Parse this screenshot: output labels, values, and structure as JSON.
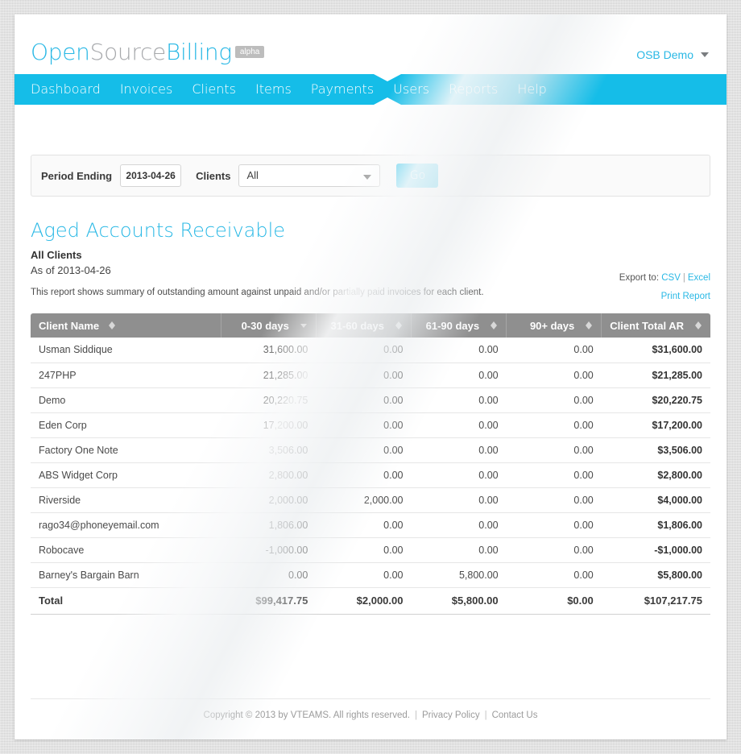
{
  "header": {
    "logo": {
      "part1": "Open",
      "part2": "Source",
      "part3": "Billing",
      "badge": "alpha"
    },
    "user_menu": "OSB Demo"
  },
  "nav": {
    "items": [
      {
        "label": "Dashboard",
        "active": false
      },
      {
        "label": "Invoices",
        "active": false
      },
      {
        "label": "Clients",
        "active": false
      },
      {
        "label": "Items",
        "active": false
      },
      {
        "label": "Payments",
        "active": false
      },
      {
        "label": "Users",
        "active": false
      },
      {
        "label": "Reports",
        "active": true
      },
      {
        "label": "Help",
        "active": false
      }
    ]
  },
  "filter": {
    "period_label": "Period Ending",
    "period_value": "2013-04-26",
    "clients_label": "Clients",
    "clients_value": "All",
    "go_label": "Go"
  },
  "report": {
    "title": "Aged Accounts Receivable",
    "subtitle": "All Clients",
    "as_of": "As of 2013-04-26",
    "description": "This report shows summary of outstanding amount against unpaid and/or partially paid invoices for each client.",
    "export_label": "Export to:",
    "export_csv": "CSV",
    "export_excel": "Excel",
    "print_report": "Print Report"
  },
  "table": {
    "columns": [
      {
        "label": "Client Name",
        "align": "left",
        "sort": "both"
      },
      {
        "label": "0-30 days",
        "align": "right",
        "sort": "desc"
      },
      {
        "label": "31-60 days",
        "align": "right",
        "sort": "both"
      },
      {
        "label": "61-90 days",
        "align": "right",
        "sort": "both"
      },
      {
        "label": "90+ days",
        "align": "right",
        "sort": "both"
      },
      {
        "label": "Client Total AR",
        "align": "right",
        "sort": "both"
      }
    ],
    "rows": [
      {
        "name": "Usman Siddique",
        "d030": "31,600.00",
        "d3160": "0.00",
        "d6190": "0.00",
        "d90": "0.00",
        "total": "$31,600.00"
      },
      {
        "name": "247PHP",
        "d030": "21,285.00",
        "d3160": "0.00",
        "d6190": "0.00",
        "d90": "0.00",
        "total": "$21,285.00"
      },
      {
        "name": "Demo",
        "d030": "20,220.75",
        "d3160": "0.00",
        "d6190": "0.00",
        "d90": "0.00",
        "total": "$20,220.75"
      },
      {
        "name": "Eden Corp",
        "d030": "17,200.00",
        "d3160": "0.00",
        "d6190": "0.00",
        "d90": "0.00",
        "total": "$17,200.00"
      },
      {
        "name": "Factory One Note",
        "d030": "3,506.00",
        "d3160": "0.00",
        "d6190": "0.00",
        "d90": "0.00",
        "total": "$3,506.00"
      },
      {
        "name": "ABS Widget Corp",
        "d030": "2,800.00",
        "d3160": "0.00",
        "d6190": "0.00",
        "d90": "0.00",
        "total": "$2,800.00"
      },
      {
        "name": "Riverside",
        "d030": "2,000.00",
        "d3160": "2,000.00",
        "d6190": "0.00",
        "d90": "0.00",
        "total": "$4,000.00"
      },
      {
        "name": "rago34@phoneyemail.com",
        "d030": "1,806.00",
        "d3160": "0.00",
        "d6190": "0.00",
        "d90": "0.00",
        "total": "$1,806.00"
      },
      {
        "name": "Robocave",
        "d030": "-1,000.00",
        "d3160": "0.00",
        "d6190": "0.00",
        "d90": "0.00",
        "total": "-$1,000.00"
      },
      {
        "name": "Barney's Bargain Barn",
        "d030": "0.00",
        "d3160": "0.00",
        "d6190": "5,800.00",
        "d90": "0.00",
        "total": "$5,800.00"
      }
    ],
    "total_row": {
      "name": "Total",
      "d030": "$99,417.75",
      "d3160": "$2,000.00",
      "d6190": "$5,800.00",
      "d90": "$0.00",
      "total": "$107,217.75"
    }
  },
  "footer": {
    "copyright": "Copyright © 2013 by VTEAMS. All rights reserved.",
    "privacy": "Privacy Policy",
    "contact": "Contact Us"
  },
  "colors": {
    "brand": "#15bde8",
    "brand_text": "#29b8e5",
    "table_header": "#8f8f8f",
    "page_bg": "#d9d9d9"
  }
}
